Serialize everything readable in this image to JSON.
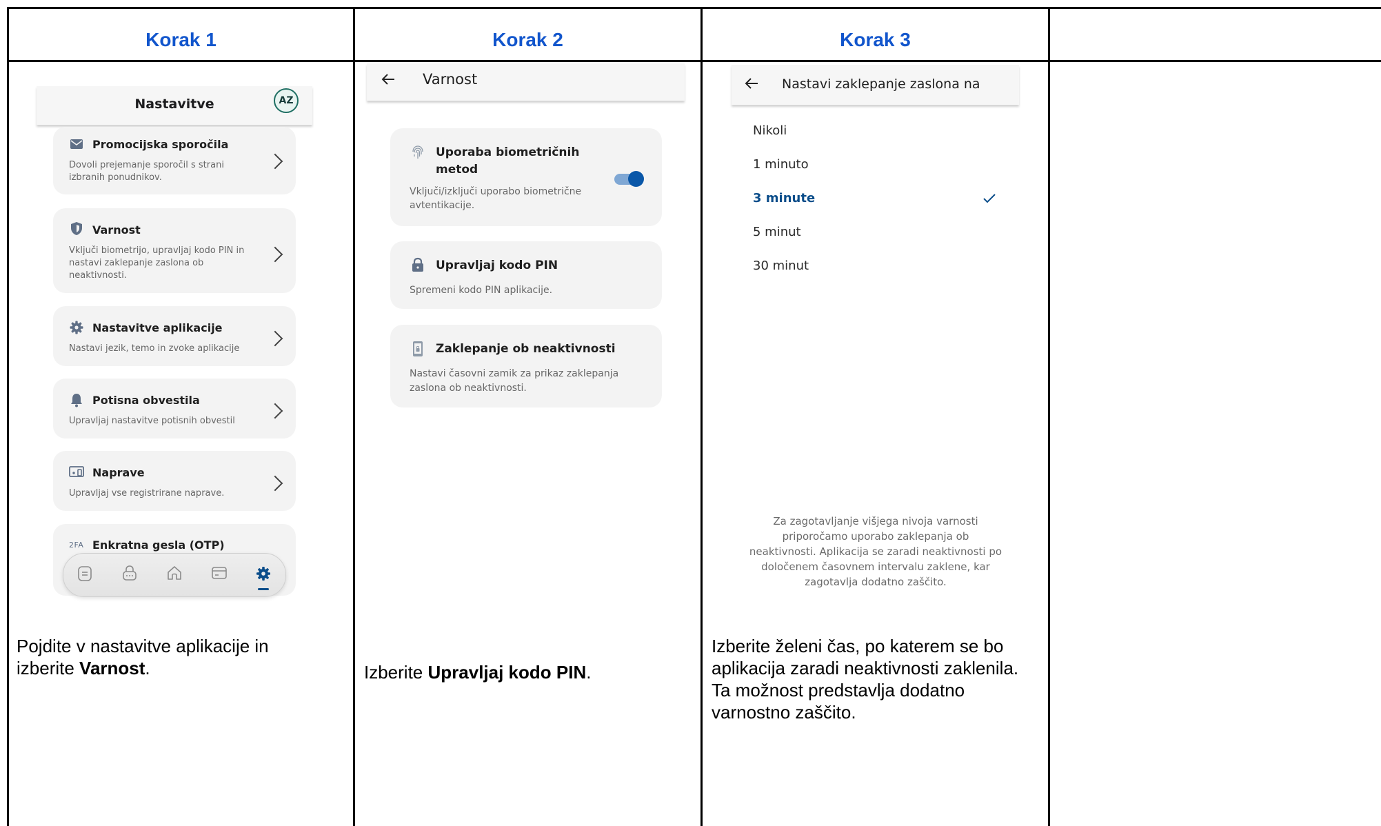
{
  "steps": [
    {
      "title": "Korak 1"
    },
    {
      "title": "Korak 2"
    },
    {
      "title": "Korak 3"
    }
  ],
  "step1": {
    "app_title": "Nastavitve",
    "avatar": "AZ",
    "items": [
      {
        "title": "Promocijska sporočila",
        "desc": "Dovoli prejemanje sporočil s strani izbranih ponudnikov.",
        "icon": "mail-icon"
      },
      {
        "title": "Varnost",
        "desc": "Vključi biometrijo, upravljaj kodo PIN in nastavi zaklepanje zaslona ob neaktivnosti.",
        "icon": "shield-icon"
      },
      {
        "title": "Nastavitve aplikacije",
        "desc": "Nastavi jezik, temo in zvoke aplikacije",
        "icon": "gear-icon"
      },
      {
        "title": "Potisna obvestila",
        "desc": "Upravljaj nastavitve potisnih obvestil",
        "icon": "bell-icon"
      },
      {
        "title": "Naprave",
        "desc": "Upravljaj vse registrirane naprave.",
        "icon": "devices-icon"
      },
      {
        "title": "Enkratna gesla (OTP)",
        "icon": "2fa-icon",
        "icon_text": "2FA"
      }
    ],
    "caption_pre": "Pojdite v nastavitve aplikacije in izberite ",
    "caption_bold": "Varnost",
    "caption_post": "."
  },
  "step2": {
    "app_title": "Varnost",
    "items": [
      {
        "title": "Uporaba biometričnih metod",
        "desc": "Vključi/izključi uporabo biometrične avtentikacije.",
        "icon": "fingerprint-icon",
        "toggle": true
      },
      {
        "title": "Upravljaj kodo PIN",
        "desc": "Spremeni kodo PIN aplikacije.",
        "icon": "lock-icon"
      },
      {
        "title": "Zaklepanje ob neaktivnosti",
        "desc": "Nastavi časovni zamik za prikaz zaklepanja zaslona ob neaktivnosti.",
        "icon": "phone-lock-icon"
      }
    ],
    "caption_pre": "Izberite ",
    "caption_bold": "Upravljaj kodo PIN",
    "caption_post": "."
  },
  "step3": {
    "app_title": "Nastavi zaklepanje zaslona na",
    "options": [
      "Nikoli",
      "1 minuto",
      "3 minute",
      "5 minut",
      "30 minut"
    ],
    "selected": "3 minute",
    "note": "Za zagotavljanje višjega nivoja varnosti priporočamo uporabo zaklepanja ob neaktivnosti. Aplikacija se zaradi neaktivnosti po določenem časovnem intervalu zaklene, kar zagotavlja dodatno zaščito.",
    "caption": "Izberite želeni čas, po katerem se bo aplikacija zaradi neaktivnosti zaklenila. Ta možnost predstavlja dodatno varnostno zaščito."
  },
  "colors": {
    "accent": "#1155cc",
    "brand": "#0b4d8a",
    "toggle": "#0a57a8"
  }
}
